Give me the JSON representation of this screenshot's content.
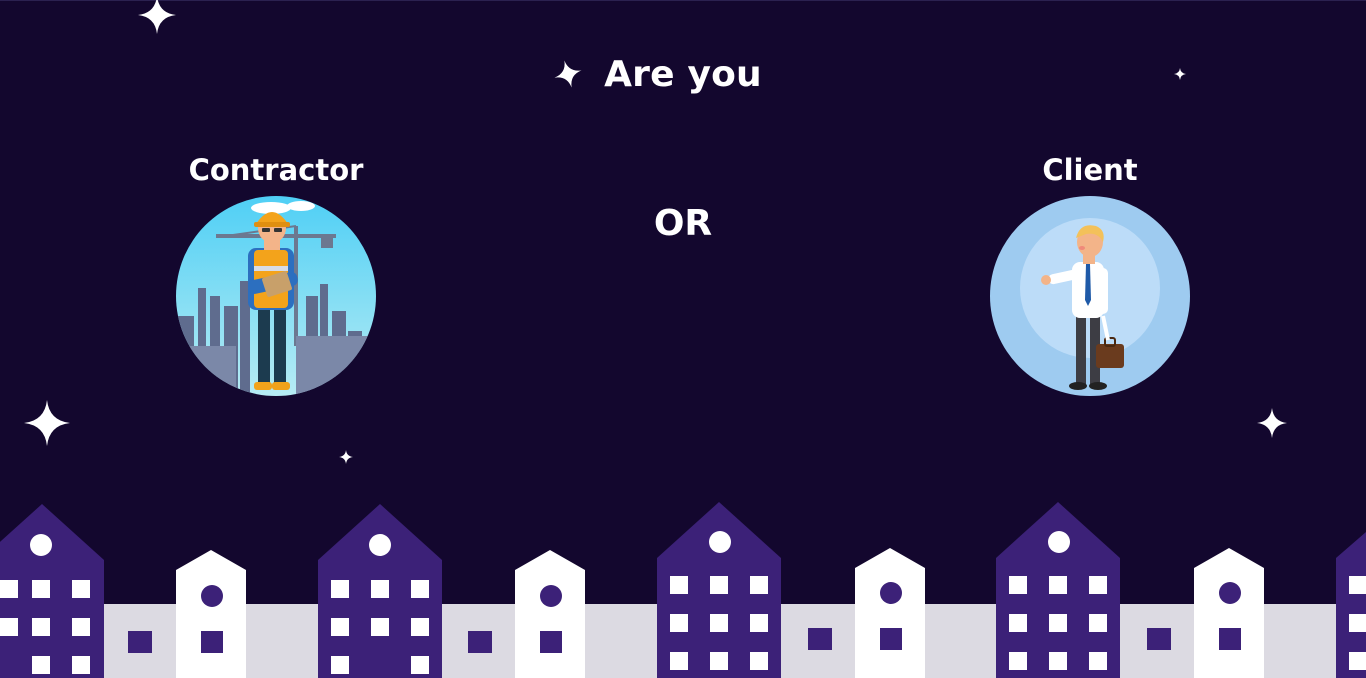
{
  "page": {
    "title": "Are you",
    "separator": "OR"
  },
  "roles": {
    "contractor": {
      "label": "Contractor",
      "icon": "contractor-illustration-icon"
    },
    "client": {
      "label": "Client",
      "icon": "client-illustration-icon"
    }
  },
  "colors": {
    "background": "#13072e",
    "building_dark": "#3c2178",
    "building_light": "#ffffff",
    "building_grey": "#dcdae2",
    "contractor_sky": "#5fd3f5",
    "client_circle": "#9ecbf0"
  }
}
